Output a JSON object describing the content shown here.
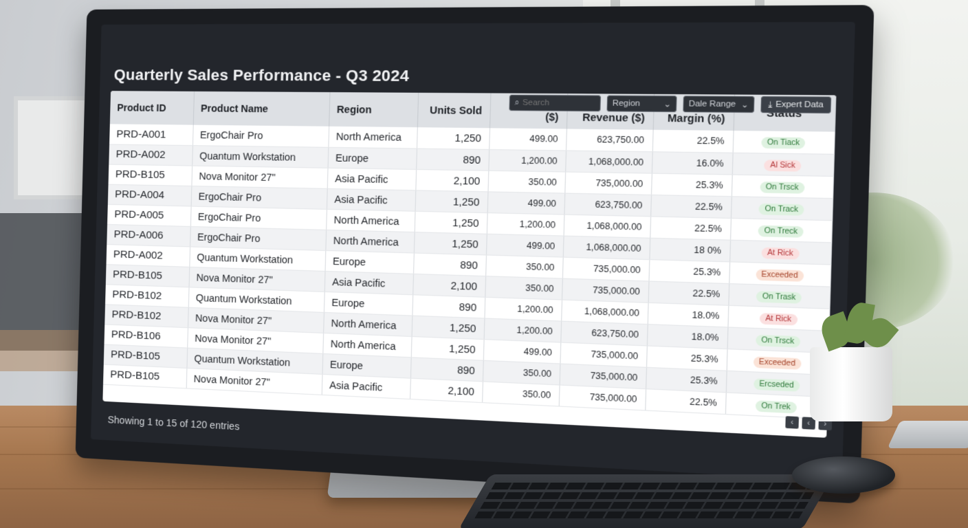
{
  "page": {
    "title": "Quarterly Sales Performance - Q3 2024",
    "footer": "Showing 1 to 15 of 120 entries"
  },
  "toolbar": {
    "search_placeholder": "Search",
    "region_select": "Region",
    "date_range_select": "Dale Range",
    "export_label": "Expert Data"
  },
  "table": {
    "columns": [
      "Product ID",
      "Product Name",
      "Region",
      "Units Sold",
      "Unit Price ($)",
      "Total Revenue ($)",
      "Profit Margin (%)",
      "Status"
    ],
    "rows": [
      {
        "id": "PRD-A001",
        "name": "ErgoChair Pro",
        "region": "North America",
        "units": "1,250",
        "price": "499.00",
        "revenue": "623,750.00",
        "margin": "22.5%",
        "status": "On Tiack",
        "status_type": "ontrack"
      },
      {
        "id": "PRD-A002",
        "name": "Quantum Workstation",
        "region": "Europe",
        "units": "890",
        "price": "1,200.00",
        "revenue": "1,068,000.00",
        "margin": "16.0%",
        "status": "Al Sick",
        "status_type": "atrisk"
      },
      {
        "id": "PRD-B105",
        "name": "Nova Monitor 27\"",
        "region": "Asia Pacific",
        "units": "2,100",
        "price": "350.00",
        "revenue": "735,000.00",
        "margin": "25.3%",
        "status": "On Trsck",
        "status_type": "ontrack"
      },
      {
        "id": "PRD-A004",
        "name": "ErgoChair Pro",
        "region": "Asia Pacific",
        "units": "1,250",
        "price": "499.00",
        "revenue": "623,750.00",
        "margin": "22.5%",
        "status": "On Track",
        "status_type": "ontrack"
      },
      {
        "id": "PRD-A005",
        "name": "ErgoChair Pro",
        "region": "North America",
        "units": "1,250",
        "price": "1,200.00",
        "revenue": "1,068,000.00",
        "margin": "22.5%",
        "status": "On Treck",
        "status_type": "ontrack"
      },
      {
        "id": "PRD-A006",
        "name": "ErgoChair Pro",
        "region": "North America",
        "units": "1,250",
        "price": "499.00",
        "revenue": "1,068,000.00",
        "margin": "18 0%",
        "status": "At Rick",
        "status_type": "atrisk"
      },
      {
        "id": "PRD-A002",
        "name": "Quantum Workstation",
        "region": "Europe",
        "units": "890",
        "price": "350.00",
        "revenue": "735,000.00",
        "margin": "25.3%",
        "status": "Exceeded",
        "status_type": "exceeded"
      },
      {
        "id": "PRD-B105",
        "name": "Nova Monitor 27\"",
        "region": "Asia Pacific",
        "units": "2,100",
        "price": "350.00",
        "revenue": "735,000.00",
        "margin": "22.5%",
        "status": "On Trask",
        "status_type": "ontrack"
      },
      {
        "id": "PRD-B102",
        "name": "Quantum Workstation",
        "region": "Europe",
        "units": "890",
        "price": "1,200.00",
        "revenue": "1,068,000.00",
        "margin": "18.0%",
        "status": "At Rick",
        "status_type": "atrisk"
      },
      {
        "id": "PRD-B102",
        "name": "Nova Monitor 27\"",
        "region": "North America",
        "units": "1,250",
        "price": "1,200.00",
        "revenue": "623,750.00",
        "margin": "18.0%",
        "status": "On Trsck",
        "status_type": "ontrack"
      },
      {
        "id": "PRD-B106",
        "name": "Nova Monitor 27\"",
        "region": "North America",
        "units": "1,250",
        "price": "499.00",
        "revenue": "735,000.00",
        "margin": "25.3%",
        "status": "Exceeded",
        "status_type": "exceeded"
      },
      {
        "id": "PRD-B105",
        "name": "Quantum Workstation",
        "region": "Europe",
        "units": "890",
        "price": "350.00",
        "revenue": "735,000.00",
        "margin": "25.3%",
        "status": "Ercseded",
        "status_type": "ontrack"
      },
      {
        "id": "PRD-B105",
        "name": "Nova Monitor 27\"",
        "region": "Asia Pacific",
        "units": "2,100",
        "price": "350.00",
        "revenue": "735,000.00",
        "margin": "22.5%",
        "status": "On Trek",
        "status_type": "ontrack"
      }
    ]
  },
  "pager": {
    "prev": "‹",
    "page": "‹",
    "next": "›"
  },
  "icons": {
    "search": "search-icon",
    "chevron": "chevron-down-icon",
    "export": "download-icon"
  }
}
